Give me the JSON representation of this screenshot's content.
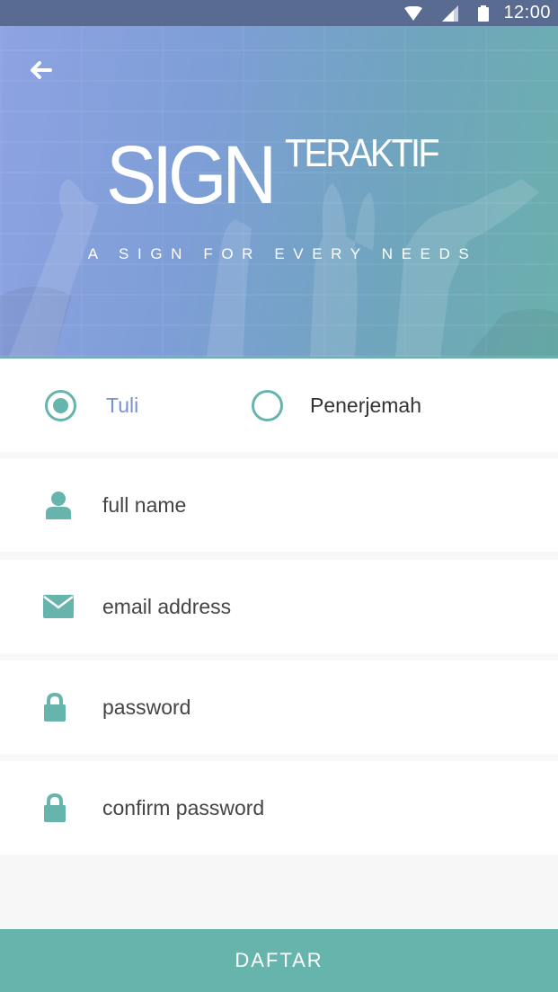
{
  "status_bar": {
    "time": "12:00",
    "icons": [
      "wifi-icon",
      "signal-icon",
      "battery-icon"
    ]
  },
  "header": {
    "back_icon": "arrow-left-icon",
    "logo_main": "SIGN",
    "logo_sup": "TERAKTIF",
    "tagline": "A SIGN FOR EVERY NEEDS"
  },
  "role": {
    "options": [
      {
        "label": "Tuli",
        "selected": true
      },
      {
        "label": "Penerjemah",
        "selected": false
      }
    ]
  },
  "form": {
    "fields": [
      {
        "icon": "user-icon",
        "placeholder": "full name"
      },
      {
        "icon": "mail-icon",
        "placeholder": "email address"
      },
      {
        "icon": "lock-icon",
        "placeholder": "password"
      },
      {
        "icon": "lock-icon",
        "placeholder": "confirm password"
      }
    ]
  },
  "submit": {
    "label": "DAFTAR"
  },
  "colors": {
    "accent": "#67b4ad",
    "selected_label": "#7b8fd4",
    "status_bar": "#5a6b91"
  }
}
